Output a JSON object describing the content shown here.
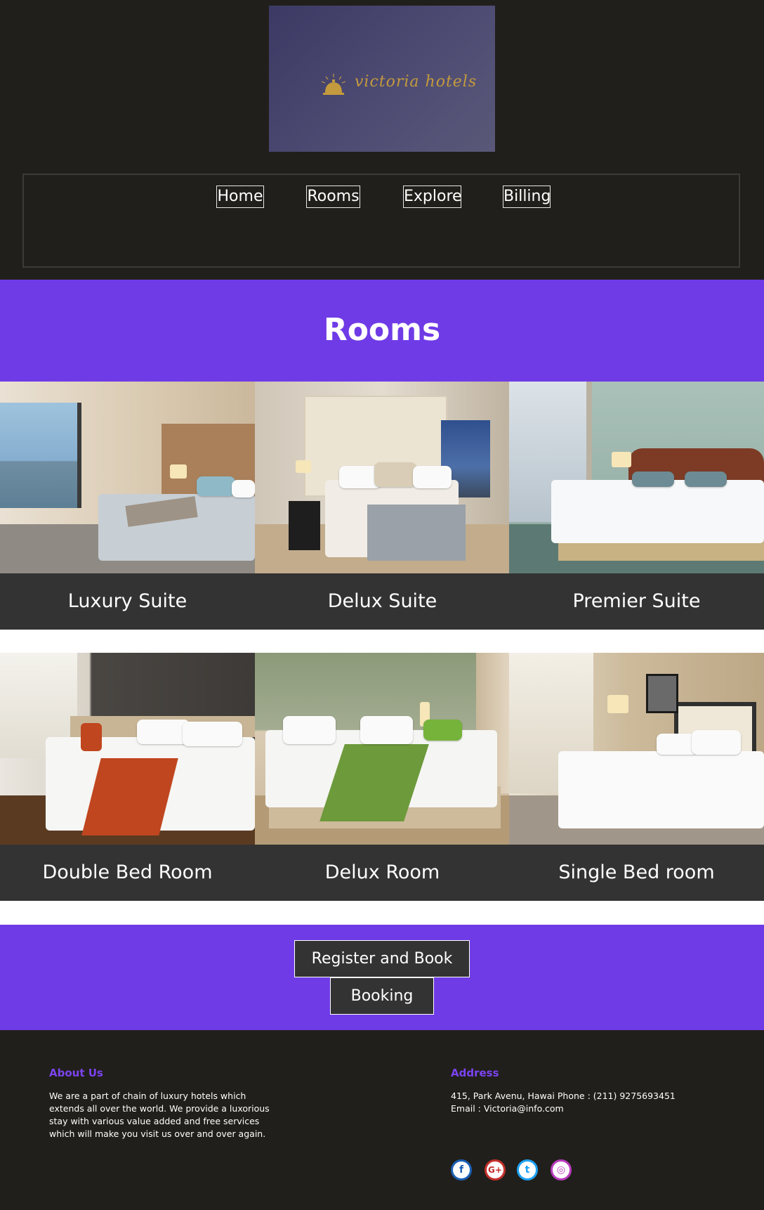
{
  "logo": {
    "text": "victoria hotels"
  },
  "nav": {
    "items": [
      "Home",
      "Rooms",
      "Explore",
      "Billing"
    ]
  },
  "rooms_section": {
    "title": "Rooms",
    "rooms": [
      {
        "name": "Luxury Suite"
      },
      {
        "name": "Delux Suite"
      },
      {
        "name": "Premier Suite"
      },
      {
        "name": "Double Bed Room"
      },
      {
        "name": "Delux Room"
      },
      {
        "name": "Single Bed room"
      }
    ]
  },
  "actions": {
    "register": "Register and Book",
    "booking": "Booking"
  },
  "footer": {
    "about": {
      "heading": "About Us",
      "lines": [
        "We are a part of chain of luxury hotels which",
        "extends all over the world. We provide a luxorious",
        "stay with various value added and free services",
        "which will make you visit us over and over again."
      ]
    },
    "address": {
      "heading": "Address",
      "lines": [
        "415, Park Avenu, Hawai Phone : (211) 9275693451",
        "Email : Victoria@info.com"
      ]
    },
    "social": [
      {
        "icon": "facebook-icon",
        "glyph": "f",
        "color": "#1a5fb4"
      },
      {
        "icon": "google-plus-icon",
        "glyph": "G+",
        "color": "#c4302b"
      },
      {
        "icon": "twitter-icon",
        "glyph": "t",
        "color": "#1da1f2"
      },
      {
        "icon": "instagram-icon",
        "glyph": "◎",
        "color": "#b93bbd"
      }
    ]
  },
  "colors": {
    "accent": "#6f3be6",
    "header_bg": "#211f1b",
    "label_bg": "#333333",
    "logo_gold": "#c49a3e"
  }
}
